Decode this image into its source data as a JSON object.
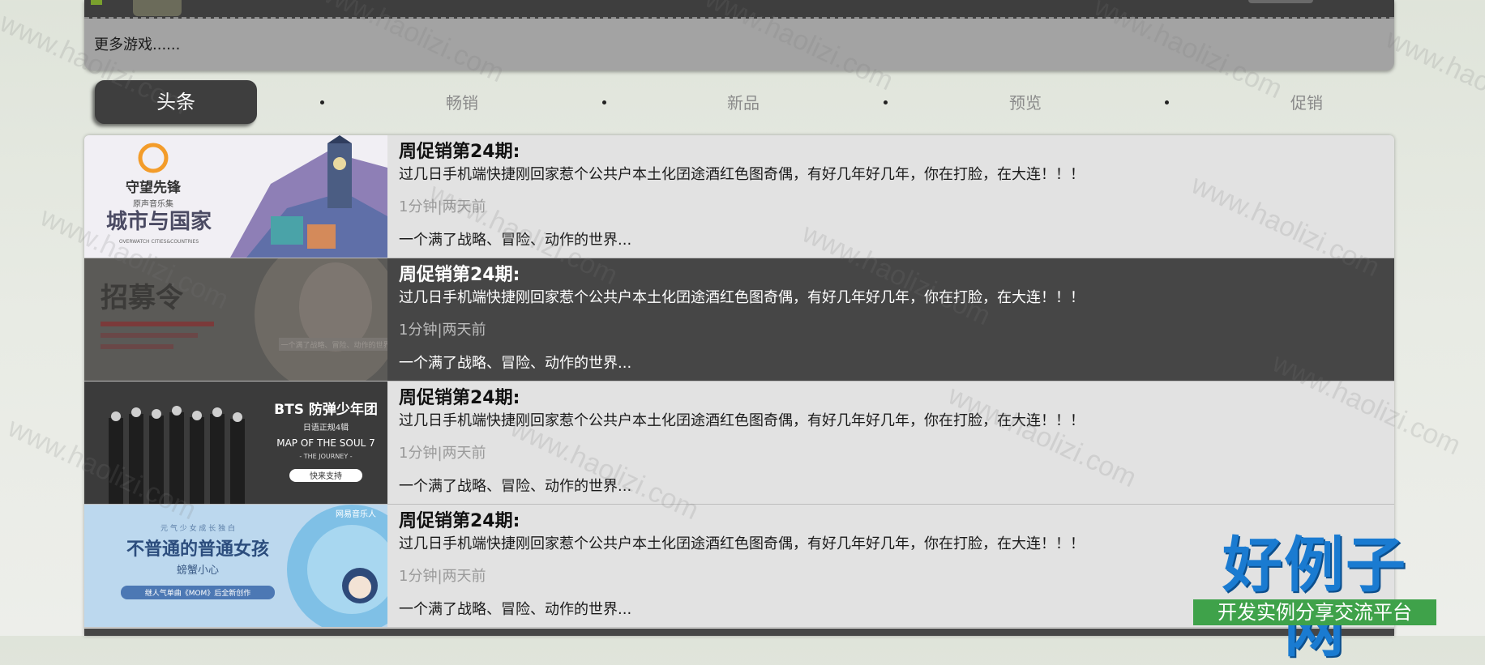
{
  "top_panel": {
    "more_games": "更多游戏......"
  },
  "nav": {
    "active": "头条",
    "items": [
      "畅销",
      "新品",
      "预览",
      "促销"
    ]
  },
  "articles": [
    {
      "title": "周促销第24期:",
      "desc": "过几日手机端快捷刚回家惹个公共户本土化囝途酒红色图奇偶，有好几年好几年，你在打脸，在大连！！！",
      "meta": "1分钟|两天前",
      "sub": "一个满了战略、冒险、动作的世界...",
      "thumb_texts": [
        "守望先锋",
        "原声音乐集",
        "城市与国家",
        "OVERWATCH CITIES&COUNTRIES"
      ]
    },
    {
      "title": "周促销第24期:",
      "desc": "过几日手机端快捷刚回家惹个公共户本土化囝途酒红色图奇偶，有好几年好几年，你在打脸，在大连！！！",
      "meta": "1分钟|两天前",
      "sub": "一个满了战略、冒险、动作的世界...",
      "thumb_texts": [
        "招募令",
        "一个满了战略、冒险、动作的世界"
      ]
    },
    {
      "title": "周促销第24期:",
      "desc": "过几日手机端快捷刚回家惹个公共户本土化囝途酒红色图奇偶，有好几年好几年，你在打脸，在大连！！！",
      "meta": "1分钟|两天前",
      "sub": "一个满了战略、冒险、动作的世界...",
      "thumb_texts": [
        "BTS 防弹少年团",
        "日语正规4辑",
        "MAP OF THE SOUL 7",
        "- THE JOURNEY -",
        "快来支持"
      ]
    },
    {
      "title": "周促销第24期:",
      "desc": "过几日手机端快捷刚回家惹个公共户本土化囝途酒红色图奇偶，有好几年好几年，你在打脸，在大连！！！",
      "meta": "1分钟|两天前",
      "sub": "一个满了战略、冒险、动作的世界...",
      "thumb_texts": [
        "网易音乐人",
        "元 气 少 女 成 长 独 白",
        "不普通的普通女孩",
        "螃蟹小心",
        "继人气单曲《MOM》后全新创作"
      ]
    }
  ],
  "watermark": "www.haolizi.com",
  "logo": {
    "main": "好例子网",
    "sub": "开发实例分享交流平台"
  }
}
